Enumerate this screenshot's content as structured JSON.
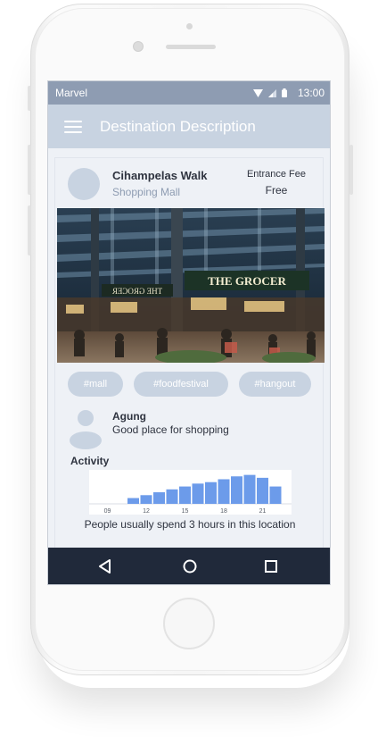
{
  "statusbar": {
    "carrier": "Marvel",
    "time": "13:00"
  },
  "appbar": {
    "title": "Destination Description"
  },
  "place": {
    "name": "Cihampelas Walk",
    "type": "Shopping Mall",
    "fee_label": "Entrance Fee",
    "fee_value": "Free"
  },
  "photo": {
    "sign_text": "THE GROCER",
    "sign_text_mirror": "THE GROCER"
  },
  "tags": [
    "#mall",
    "#foodfestival",
    "#hangout"
  ],
  "review": {
    "user": "Agung",
    "text": "Good place for shopping"
  },
  "activity": {
    "label": "Activity",
    "caption": "People usually spend 3 hours in this location"
  },
  "chart_data": {
    "type": "bar",
    "x": [
      9,
      10,
      11,
      12,
      13,
      14,
      15,
      16,
      17,
      18,
      19,
      20,
      21,
      22
    ],
    "values": [
      0,
      0,
      2,
      3,
      4,
      5,
      6,
      7,
      7.5,
      8.5,
      9.5,
      10,
      9,
      6
    ],
    "tick_labels": [
      "09",
      "12",
      "15",
      "18",
      "21"
    ],
    "ylim": [
      0,
      10.5
    ],
    "color": "#6c9bea"
  },
  "colors": {
    "accent": "#c8d3e1",
    "statusbar": "#8e9cb2",
    "navbar": "#20293a"
  },
  "navbar": {
    "icons": [
      "back-icon",
      "home-icon",
      "recents-icon"
    ]
  }
}
